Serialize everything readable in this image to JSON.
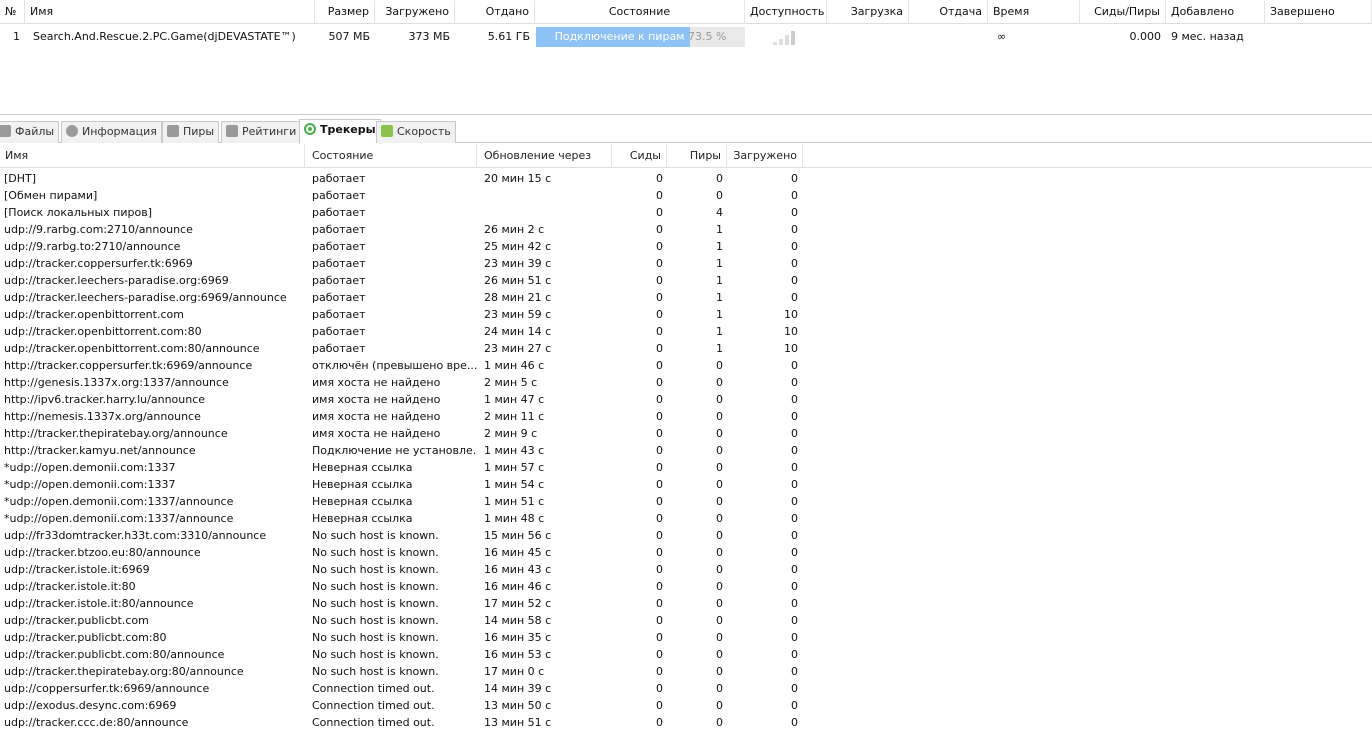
{
  "torrent_list": {
    "columns": [
      "№",
      "Имя",
      "Размер",
      "Загружено",
      "Отдано",
      "Состояние",
      "Доступность",
      "Загрузка",
      "Отдача",
      "Время",
      "Сиды/Пиры",
      "Добавлено",
      "Завершено"
    ],
    "row": {
      "num": "1",
      "name": "Search.And.Rescue.2.PC.Game(djDEVASTATE™)",
      "size": "507 МБ",
      "downloaded": "373 МБ",
      "uploaded": "5.61 ГБ",
      "status": "Подключение к пирам",
      "percent_label": "73.5 %",
      "progress": 73.5,
      "time": "∞",
      "ratio": "0.000",
      "added": "9 мес. назад"
    }
  },
  "tabs": [
    {
      "label": "Файлы",
      "icon": "files-icon"
    },
    {
      "label": "Информация",
      "icon": "info-icon"
    },
    {
      "label": "Пиры",
      "icon": "peers-icon"
    },
    {
      "label": "Рейтинги",
      "icon": "ratings-icon"
    },
    {
      "label": "Трекеры",
      "icon": "trackers-icon",
      "active": true
    },
    {
      "label": "Скорость",
      "icon": "speed-icon"
    }
  ],
  "trackers": {
    "columns": [
      "Имя",
      "Состояние",
      "Обновление через",
      "Сиды",
      "Пиры",
      "Загружено"
    ],
    "rows": [
      [
        "[DHT]",
        "работает",
        "20 мин 15 с",
        "0",
        "0",
        "0"
      ],
      [
        "[Обмен пирами]",
        "работает",
        "",
        "0",
        "0",
        "0"
      ],
      [
        "[Поиск локальных пиров]",
        "работает",
        "",
        "0",
        "4",
        "0"
      ],
      [
        "udp://9.rarbg.com:2710/announce",
        "работает",
        "26 мин 2 с",
        "0",
        "1",
        "0"
      ],
      [
        "udp://9.rarbg.to:2710/announce",
        "работает",
        "25 мин 42 с",
        "0",
        "1",
        "0"
      ],
      [
        "udp://tracker.coppersurfer.tk:6969",
        "работает",
        "23 мин 39 с",
        "0",
        "1",
        "0"
      ],
      [
        "udp://tracker.leechers-paradise.org:6969",
        "работает",
        "26 мин 51 с",
        "0",
        "1",
        "0"
      ],
      [
        "udp://tracker.leechers-paradise.org:6969/announce",
        "работает",
        "28 мин 21 с",
        "0",
        "1",
        "0"
      ],
      [
        "udp://tracker.openbittorrent.com",
        "работает",
        "23 мин 59 с",
        "0",
        "1",
        "10"
      ],
      [
        "udp://tracker.openbittorrent.com:80",
        "работает",
        "24 мин 14 с",
        "0",
        "1",
        "10"
      ],
      [
        "udp://tracker.openbittorrent.com:80/announce",
        "работает",
        "23 мин 27 с",
        "0",
        "1",
        "10"
      ],
      [
        "http://tracker.coppersurfer.tk:6969/announce",
        "отключён (превышено вре...",
        "1 мин 46 с",
        "0",
        "0",
        "0"
      ],
      [
        "http://genesis.1337x.org:1337/announce",
        "имя хоста не найдено",
        "2 мин 5 с",
        "0",
        "0",
        "0"
      ],
      [
        "http://ipv6.tracker.harry.lu/announce",
        "имя хоста не найдено",
        "1 мин 47 с",
        "0",
        "0",
        "0"
      ],
      [
        "http://nemesis.1337x.org/announce",
        "имя хоста не найдено",
        "2 мин 11 с",
        "0",
        "0",
        "0"
      ],
      [
        "http://tracker.thepiratebay.org/announce",
        "имя хоста не найдено",
        "2 мин 9 с",
        "0",
        "0",
        "0"
      ],
      [
        "http://tracker.kamyu.net/announce",
        "Подключение не установле...",
        "1 мин 43 с",
        "0",
        "0",
        "0"
      ],
      [
        "*udp://open.demonii.com:1337",
        "Неверная ссылка",
        "1 мин 57 с",
        "0",
        "0",
        "0"
      ],
      [
        "*udp://open.demonii.com:1337",
        "Неверная ссылка",
        "1 мин 54 с",
        "0",
        "0",
        "0"
      ],
      [
        "*udp://open.demonii.com:1337/announce",
        "Неверная ссылка",
        "1 мин 51 с",
        "0",
        "0",
        "0"
      ],
      [
        "*udp://open.demonii.com:1337/announce",
        "Неверная ссылка",
        "1 мин 48 с",
        "0",
        "0",
        "0"
      ],
      [
        "udp://fr33domtracker.h33t.com:3310/announce",
        "No such host is known.",
        "15 мин 56 с",
        "0",
        "0",
        "0"
      ],
      [
        "udp://tracker.btzoo.eu:80/announce",
        "No such host is known.",
        "16 мин 45 с",
        "0",
        "0",
        "0"
      ],
      [
        "udp://tracker.istole.it:6969",
        "No such host is known.",
        "16 мин 43 с",
        "0",
        "0",
        "0"
      ],
      [
        "udp://tracker.istole.it:80",
        "No such host is known.",
        "16 мин 46 с",
        "0",
        "0",
        "0"
      ],
      [
        "udp://tracker.istole.it:80/announce",
        "No such host is known.",
        "17 мин 52 с",
        "0",
        "0",
        "0"
      ],
      [
        "udp://tracker.publicbt.com",
        "No such host is known.",
        "14 мин 58 с",
        "0",
        "0",
        "0"
      ],
      [
        "udp://tracker.publicbt.com:80",
        "No such host is known.",
        "16 мин 35 с",
        "0",
        "0",
        "0"
      ],
      [
        "udp://tracker.publicbt.com:80/announce",
        "No such host is known.",
        "16 мин 53 с",
        "0",
        "0",
        "0"
      ],
      [
        "udp://tracker.thepiratebay.org:80/announce",
        "No such host is known.",
        "17 мин 0 с",
        "0",
        "0",
        "0"
      ],
      [
        "udp://coppersurfer.tk:6969/announce",
        "Connection timed out.",
        "14 мин 39 с",
        "0",
        "0",
        "0"
      ],
      [
        "udp://exodus.desync.com:6969",
        "Connection timed out.",
        "13 мин 50 с",
        "0",
        "0",
        "0"
      ],
      [
        "udp://tracker.ccc.de:80/announce",
        "Connection timed out.",
        "13 мин 51 с",
        "0",
        "0",
        "0"
      ]
    ]
  },
  "colors": {
    "progress": "#8ec1f5",
    "active_tab_icon": "#4caf50"
  }
}
